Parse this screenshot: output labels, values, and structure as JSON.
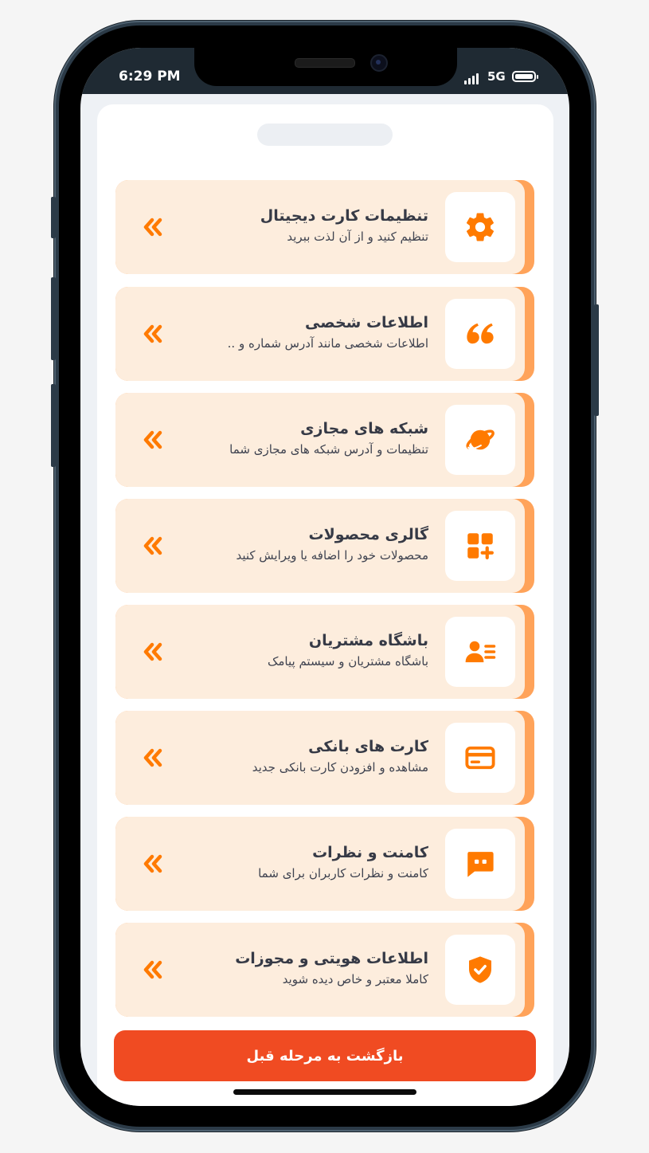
{
  "status_bar": {
    "time": "6:29 PM",
    "network": "5G"
  },
  "menu": [
    {
      "title": "تنظیمات کارت دیجیتال",
      "subtitle": "تنظیم کنید و از آن لذت ببرید",
      "icon": "gear-icon"
    },
    {
      "title": "اطلاعات شخصی",
      "subtitle": "اطلاعات شخصی مانند آدرس شماره و ..",
      "icon": "quote-icon"
    },
    {
      "title": "شبکه های مجازی",
      "subtitle": "تنظیمات و آدرس شبکه های مجازی شما",
      "icon": "planet-icon"
    },
    {
      "title": "گالری محصولات",
      "subtitle": "محصولات خود را اضافه یا ویرایش کنید",
      "icon": "grid-add-icon"
    },
    {
      "title": "باشگاه مشتریان",
      "subtitle": "باشگاه مشتریان و سیستم پیامک",
      "icon": "user-list-icon"
    },
    {
      "title": "کارت های بانکی",
      "subtitle": "مشاهده و افزودن کارت بانکی جدید",
      "icon": "credit-card-icon"
    },
    {
      "title": "کامنت و نظرات",
      "subtitle": "کامنت و نظرات کاربران برای شما",
      "icon": "chat-icon"
    },
    {
      "title": "اطلاعات هویتی و مجوزات",
      "subtitle": "کاملا معتبر و خاص دیده شوید",
      "icon": "shield-check-icon"
    }
  ],
  "back_button_label": "بازگشت به مرحله قبل",
  "colors": {
    "accent": "#ff7a00",
    "card_bg": "#fdeddd",
    "card_edge": "#ffa35a",
    "button": "#f04b22"
  }
}
